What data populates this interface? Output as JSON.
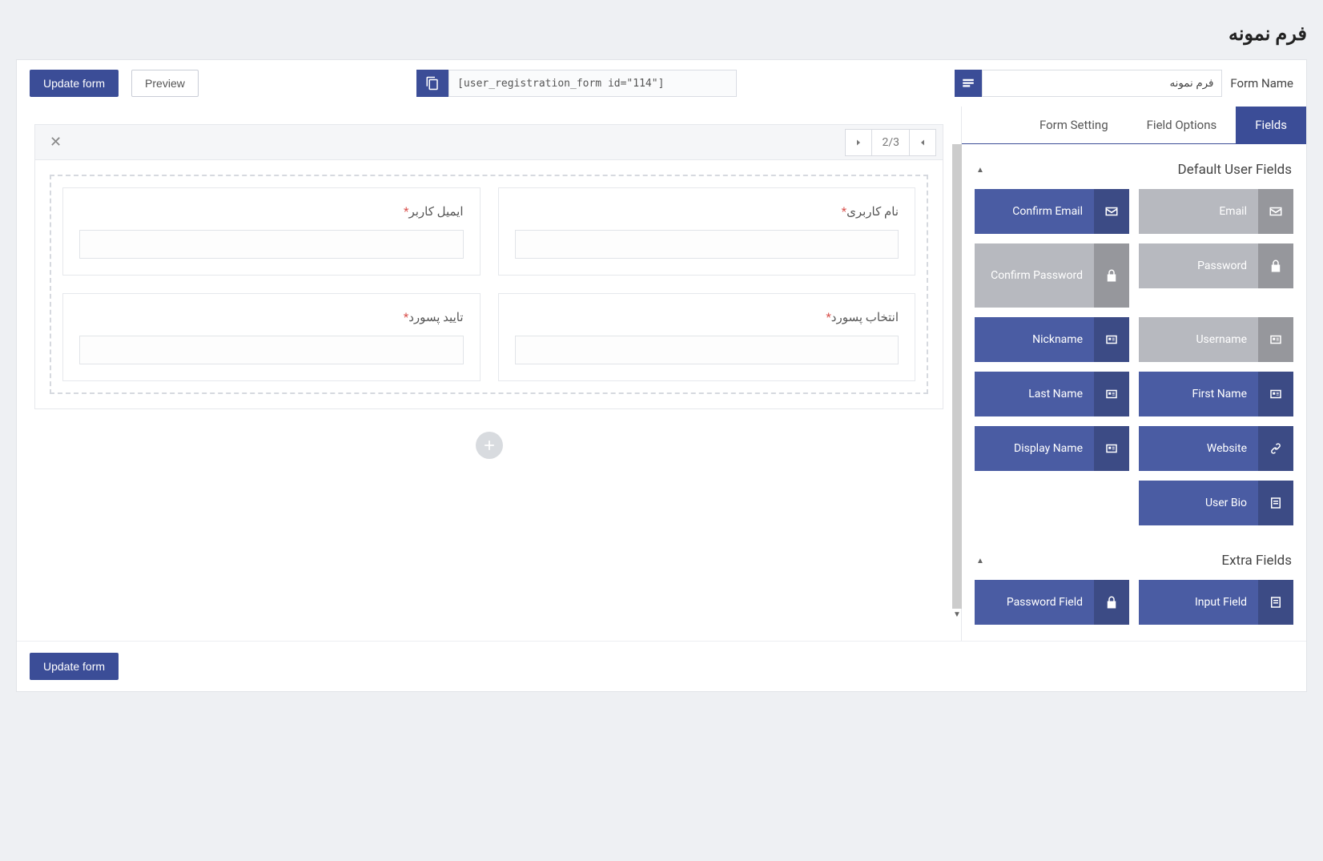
{
  "page_title": "فرم نمونه",
  "topbar": {
    "update_label": "Update form",
    "preview_label": "Preview",
    "shortcode_value": "[user_registration_form id=\"114\"]",
    "form_name_label": "Form Name",
    "form_name_value": "فرم نمونه"
  },
  "tabs": {
    "form_setting": "Form Setting",
    "field_options": "Field Options",
    "fields": "Fields",
    "active": "fields"
  },
  "sections": {
    "default_title": "Default User Fields",
    "extra_title": "Extra Fields"
  },
  "default_fields": [
    {
      "label": "Email",
      "icon": "mail",
      "disabled": true
    },
    {
      "label": "Confirm Email",
      "icon": "mail",
      "disabled": false
    },
    {
      "label": "Password",
      "icon": "lock",
      "disabled": true
    },
    {
      "label": "Confirm Password",
      "icon": "lock",
      "disabled": true,
      "tall": true
    },
    {
      "label": "Username",
      "icon": "card",
      "disabled": true
    },
    {
      "label": "Nickname",
      "icon": "card",
      "disabled": false
    },
    {
      "label": "First Name",
      "icon": "card",
      "disabled": false
    },
    {
      "label": "Last Name",
      "icon": "card",
      "disabled": false
    },
    {
      "label": "Website",
      "icon": "link",
      "disabled": false
    },
    {
      "label": "Display Name",
      "icon": "card",
      "disabled": false
    },
    {
      "label": "User Bio",
      "icon": "doc",
      "disabled": false
    }
  ],
  "extra_fields": [
    {
      "label": "Input Field",
      "icon": "doc",
      "disabled": false
    },
    {
      "label": "Password Field",
      "icon": "lock",
      "disabled": false
    }
  ],
  "canvas": {
    "pager": "2/3",
    "rows": [
      [
        {
          "label": "نام کاربری",
          "required": true
        },
        {
          "label": "ایمیل کاربر",
          "required": true
        }
      ],
      [
        {
          "label": "انتخاب پسورد",
          "required": true
        },
        {
          "label": "تایید پسورد",
          "required": true
        }
      ]
    ]
  },
  "footer": {
    "update_label": "Update form"
  }
}
